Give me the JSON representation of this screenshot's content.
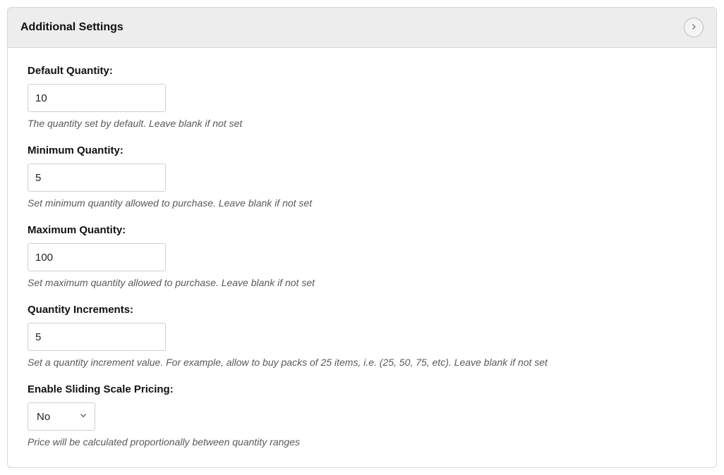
{
  "panel": {
    "title": "Additional Settings"
  },
  "fields": {
    "default_quantity": {
      "label": "Default Quantity:",
      "value": "10",
      "help": "The quantity set by default. Leave blank if not set"
    },
    "minimum_quantity": {
      "label": "Minimum Quantity:",
      "value": "5",
      "help": "Set minimum quantity allowed to purchase. Leave blank if not set"
    },
    "maximum_quantity": {
      "label": "Maximum Quantity:",
      "value": "100",
      "help": "Set maximum quantity allowed to purchase. Leave blank if not set"
    },
    "quantity_increments": {
      "label": "Quantity Increments:",
      "value": "5",
      "help": "Set a quantity increment value. For example, allow to buy packs of 25 items, i.e. (25, 50, 75, etc). Leave blank if not set"
    },
    "sliding_scale": {
      "label": "Enable Sliding Scale Pricing:",
      "value": "No",
      "help": "Price will be calculated proportionally between quantity ranges"
    }
  }
}
